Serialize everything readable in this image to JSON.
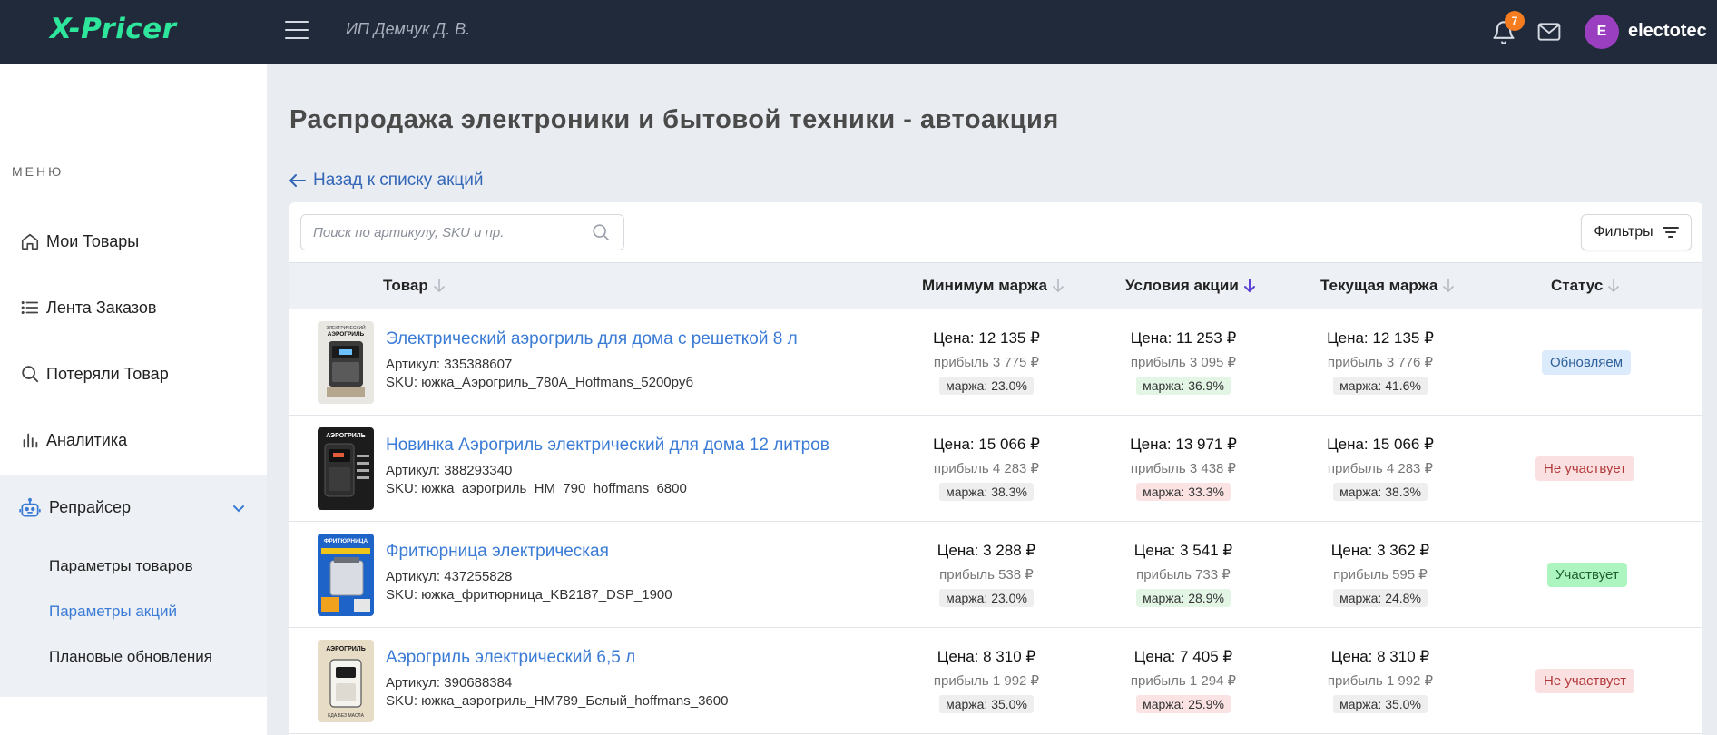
{
  "header": {
    "logo": "X-Pricer",
    "org_name": "ИП Демчук Д. В.",
    "notifications_count": "7",
    "avatar_letter": "E",
    "username": "electotec"
  },
  "sidebar": {
    "menu_title": "МЕНЮ",
    "items": [
      {
        "label": "Мои Товары",
        "icon": "home-icon"
      },
      {
        "label": "Лента Заказов",
        "icon": "list-icon"
      },
      {
        "label": "Потеряли Товар",
        "icon": "search-icon"
      },
      {
        "label": "Аналитика",
        "icon": "bar-chart-icon"
      },
      {
        "label": "Репрайсер",
        "icon": "robot-icon"
      }
    ],
    "subitems": [
      {
        "label": "Параметры товаров"
      },
      {
        "label": "Параметры акций"
      },
      {
        "label": "Плановые обновления"
      }
    ]
  },
  "page": {
    "title": "Распродажа электроники и бытовой техники - автоакция",
    "back_link": "Назад к списку акций",
    "search_placeholder": "Поиск по артикулу, SKU и пр.",
    "filters_label": "Фильтры"
  },
  "table": {
    "columns": [
      "Товар",
      "Минимум маржа",
      "Условия акции",
      "Текущая маржа",
      "Статус"
    ],
    "rows": [
      {
        "name": "Электрический аэрогриль для дома с решеткой 8 л",
        "article": "Артикул: 335388607",
        "sku": "SKU: южка_Аэрогриль_780A_Hoffmans_5200руб",
        "min": {
          "price": "Цена: 12 135 ₽",
          "profit": "прибыль 3 775 ₽",
          "margin": "маржа: 23.0%"
        },
        "promo": {
          "price": "Цена: 11 253 ₽",
          "profit": "прибыль 3 095 ₽",
          "margin": "маржа: 36.9%"
        },
        "current": {
          "price": "Цена: 12 135 ₽",
          "profit": "прибыль 3 776 ₽",
          "margin": "маржа: 41.6%"
        },
        "status": "Обновляем"
      },
      {
        "name": "Новинка Аэрогриль электрический для дома 12 литров",
        "article": "Артикул: 388293340",
        "sku": "SKU: южка_аэрогриль_HM_790_hoffmans_6800",
        "min": {
          "price": "Цена: 15 066 ₽",
          "profit": "прибыль 4 283 ₽",
          "margin": "маржа: 38.3%"
        },
        "promo": {
          "price": "Цена: 13 971 ₽",
          "profit": "прибыль 3 438 ₽",
          "margin": "маржа: 33.3%"
        },
        "current": {
          "price": "Цена: 15 066 ₽",
          "profit": "прибыль 4 283 ₽",
          "margin": "маржа: 38.3%"
        },
        "status": "Не участвует"
      },
      {
        "name": "Фритюрница электрическая",
        "article": "Артикул: 437255828",
        "sku": "SKU: южка_фритюрница_KB2187_DSP_1900",
        "min": {
          "price": "Цена: 3 288 ₽",
          "profit": "прибыль 538 ₽",
          "margin": "маржа: 23.0%"
        },
        "promo": {
          "price": "Цена: 3 541 ₽",
          "profit": "прибыль 733 ₽",
          "margin": "маржа: 28.9%"
        },
        "current": {
          "price": "Цена: 3 362 ₽",
          "profit": "прибыль 595 ₽",
          "margin": "маржа: 24.8%"
        },
        "status": "Участвует"
      },
      {
        "name": "Аэрогриль электрический 6,5 л",
        "article": "Артикул: 390688384",
        "sku": "SKU: южка_аэрогриль_HM789_Белый_hoffmans_3600",
        "min": {
          "price": "Цена: 8 310 ₽",
          "profit": "прибыль 1 992 ₽",
          "margin": "маржа: 35.0%"
        },
        "promo": {
          "price": "Цена: 7 405 ₽",
          "profit": "прибыль 1 294 ₽",
          "margin": "маржа: 25.9%"
        },
        "current": {
          "price": "Цена: 8 310 ₽",
          "profit": "прибыль 1 992 ₽",
          "margin": "маржа: 35.0%"
        },
        "status": "Не участвует"
      }
    ],
    "thumbs": [
      {
        "caption": "ЭЛЕКТРИЧЕСКИЙ АЭРОГРИЛЬ"
      },
      {
        "caption": "АЭРОГРИЛЬ"
      },
      {
        "caption": "ФРИТЮРНИЦА"
      },
      {
        "caption": "АЭРОГРИЛЬ",
        "sub": "ЕДА БЕЗ МАСЛА"
      }
    ]
  },
  "colors": {
    "topbar": "#212a3a",
    "logo": "#2ee59c",
    "accent": "#3a7bd5",
    "badge": "#f57c1f",
    "avatar": "#9b3fc1"
  }
}
